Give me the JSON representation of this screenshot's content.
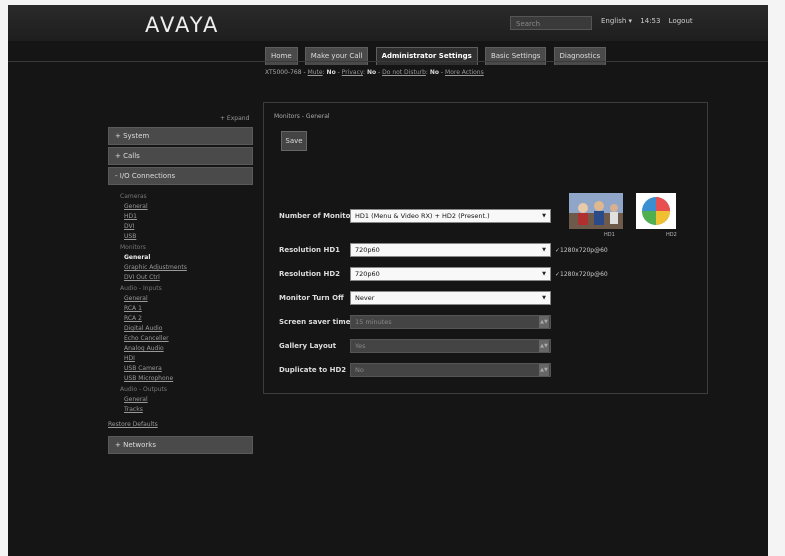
{
  "header": {
    "logo": "AVAYA",
    "search_placeholder": "Search",
    "language": "English ▾",
    "time": "14:53",
    "logout": "Logout"
  },
  "tabs": [
    "Home",
    "Make your Call",
    "Administrator Settings",
    "Basic Settings",
    "Diagnostics"
  ],
  "breadcrumb": {
    "device": "XT5000-768",
    "sep1": "-",
    "mute_label": "Mute",
    "mute_value": "No",
    "sep2": "-",
    "privacy_label": "Privacy",
    "privacy_value": "No",
    "sep3": "-",
    "dnd_label": "Do not Disturb",
    "dnd_value": "No",
    "sep4": "-",
    "more_label": "More Actions"
  },
  "sidebar": {
    "expand": "+ Expand",
    "sections": [
      "+ System",
      "+ Calls",
      "- I/O Connections"
    ],
    "groups": [
      {
        "title": "Cameras",
        "items": [
          "General",
          "HD1",
          "DVI",
          "USB"
        ]
      },
      {
        "title": "Monitors",
        "items": [
          "General",
          "Graphic Adjustments",
          "DVI Out Ctrl"
        ]
      },
      {
        "title": "Audio - Inputs",
        "items": [
          "General",
          "RCA 1",
          "RCA 2",
          "Digital Audio",
          "Echo Canceller",
          "Analog Audio",
          "HDI",
          "USB Camera",
          "USB Microphone"
        ]
      },
      {
        "title": "Audio - Outputs",
        "items": [
          "General",
          "Tracks"
        ]
      }
    ],
    "current_item": "Monitors.General",
    "restore": "Restore Defaults",
    "network": "+ Networks"
  },
  "panel": {
    "title": "Monitors - General",
    "save": "Save",
    "fields": [
      {
        "label": "Number of Monitors",
        "value": "HD1 (Menu & Video RX) + HD2 (Present.)",
        "disabled": false
      },
      {
        "label": "Resolution HD1",
        "value": "720p60",
        "disabled": false,
        "note": "✓1280x720p@60"
      },
      {
        "label": "Resolution HD2",
        "value": "720p60",
        "disabled": false,
        "note": "✓1280x720p@60"
      },
      {
        "label": "Monitor Turn Off",
        "value": "Never",
        "disabled": false
      },
      {
        "label": "Screen saver timeout",
        "value": "15 minutes",
        "disabled": true
      },
      {
        "label": "Gallery Layout",
        "value": "Yes",
        "disabled": true
      },
      {
        "label": "Duplicate to HD2",
        "value": "No",
        "disabled": true
      }
    ],
    "thumb1_label": "HD1",
    "thumb2_label": "HD2"
  }
}
